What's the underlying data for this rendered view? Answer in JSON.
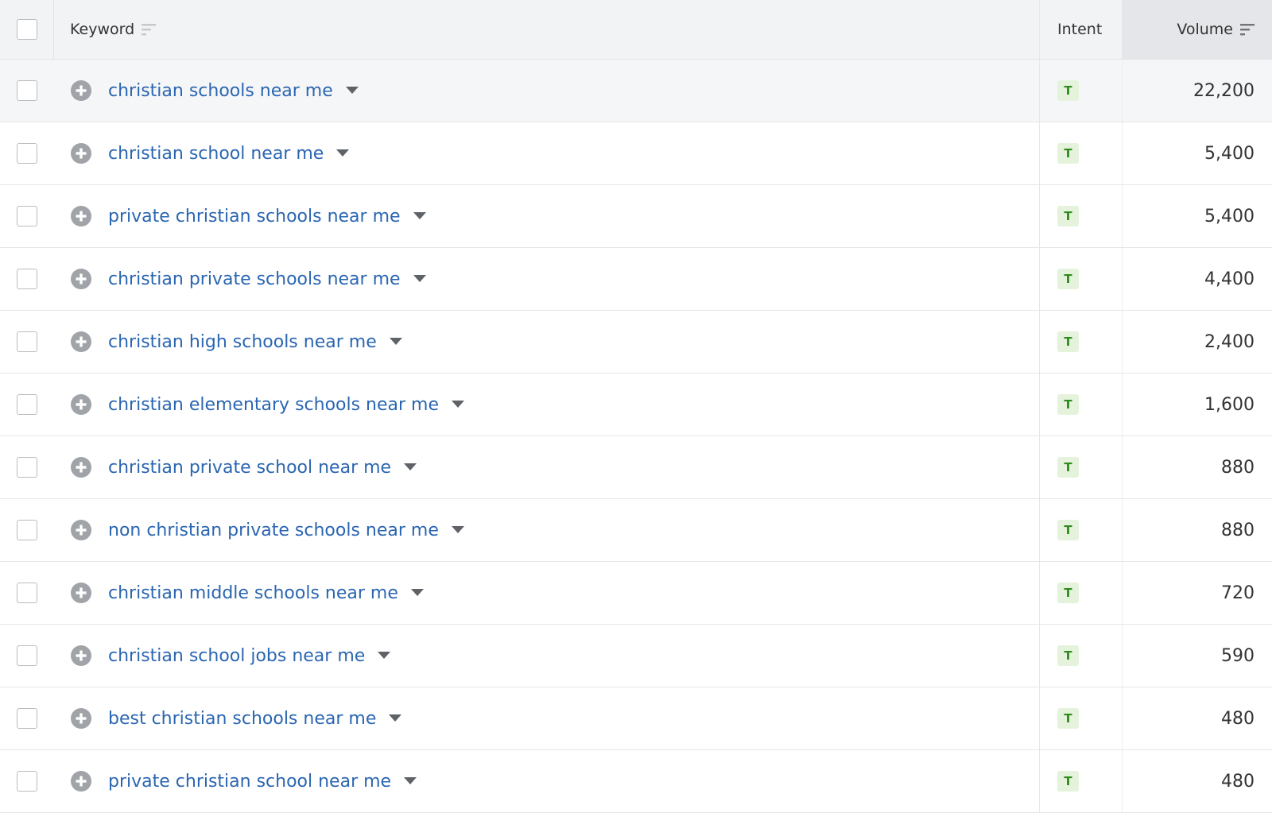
{
  "header": {
    "keyword_label": "Keyword",
    "intent_label": "Intent",
    "volume_label": "Volume"
  },
  "icons": {
    "add": "plus-circle-icon",
    "expand": "caret-down-icon",
    "sort": "sort-lines-icon"
  },
  "colors": {
    "link": "#2b66b1",
    "intent_badge_bg": "#e6f3dc",
    "intent_badge_text": "#2f8a1e",
    "header_bg": "#f2f3f5",
    "sorted_column_bg": "#e4e6e9",
    "plus_icon": "#a0a3a8"
  },
  "rows": [
    {
      "keyword": "christian schools near me",
      "intent": "T",
      "volume": "22,200"
    },
    {
      "keyword": "christian school near me",
      "intent": "T",
      "volume": "5,400"
    },
    {
      "keyword": "private christian schools near me",
      "intent": "T",
      "volume": "5,400"
    },
    {
      "keyword": "christian private schools near me",
      "intent": "T",
      "volume": "4,400"
    },
    {
      "keyword": "christian high schools near me",
      "intent": "T",
      "volume": "2,400"
    },
    {
      "keyword": "christian elementary schools near me",
      "intent": "T",
      "volume": "1,600"
    },
    {
      "keyword": "christian private school near me",
      "intent": "T",
      "volume": "880"
    },
    {
      "keyword": "non christian private schools near me",
      "intent": "T",
      "volume": "880"
    },
    {
      "keyword": "christian middle schools near me",
      "intent": "T",
      "volume": "720"
    },
    {
      "keyword": "christian school jobs near me",
      "intent": "T",
      "volume": "590"
    },
    {
      "keyword": "best christian schools near me",
      "intent": "T",
      "volume": "480"
    },
    {
      "keyword": "private christian school near me",
      "intent": "T",
      "volume": "480"
    }
  ]
}
